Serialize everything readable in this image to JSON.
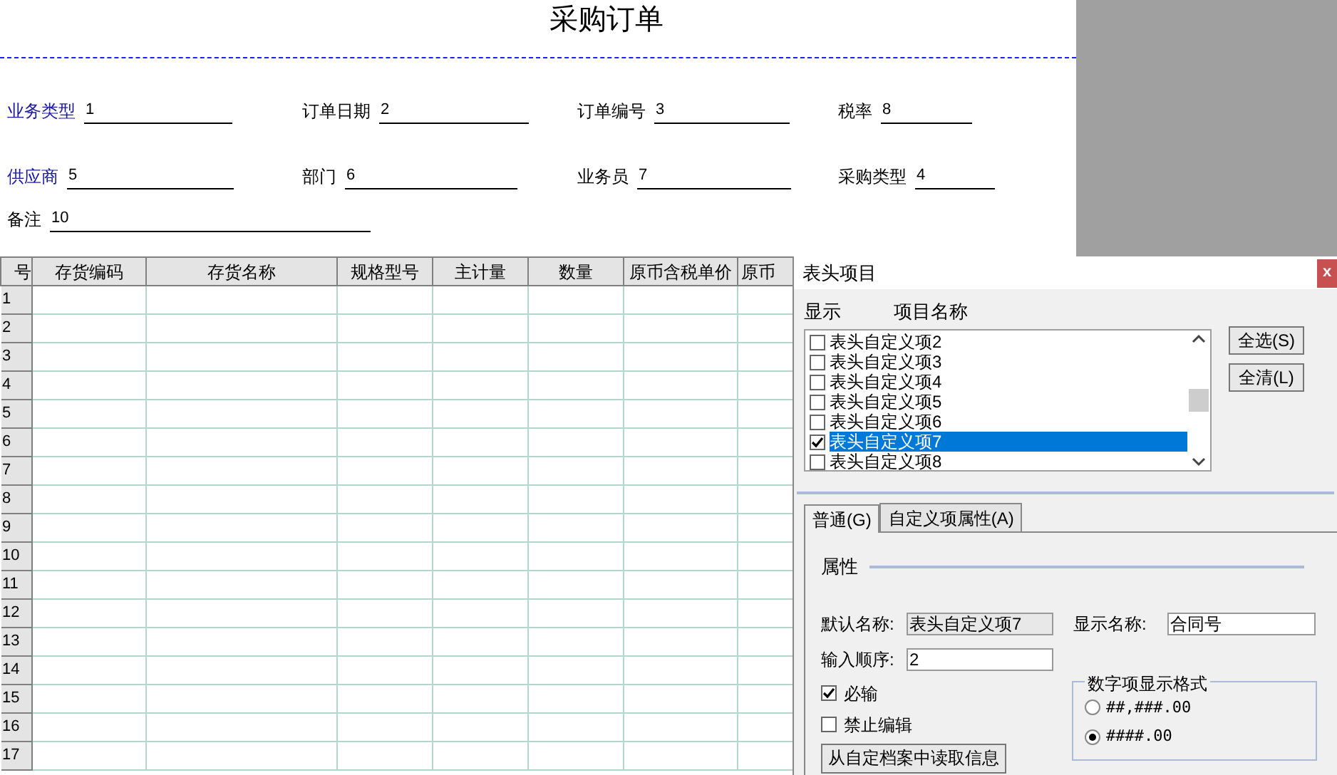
{
  "document": {
    "title": "采购订单",
    "field_rows": [
      {
        "fields": [
          {
            "label": "业务类型",
            "value": "1",
            "required": true
          },
          {
            "label": "订单日期",
            "value": "2",
            "required": false
          },
          {
            "label": "订单编号",
            "value": "3",
            "required": false
          },
          {
            "label": "税率",
            "value": "8",
            "required": false
          }
        ]
      },
      {
        "fields": [
          {
            "label": "供应商",
            "value": "5",
            "required": true
          },
          {
            "label": "部门",
            "value": "6",
            "required": false
          },
          {
            "label": "业务员",
            "value": "7",
            "required": false
          },
          {
            "label": "采购类型",
            "value": "4",
            "required": false
          }
        ]
      },
      {
        "fields": [
          {
            "label": "备注",
            "value": "10",
            "required": false
          }
        ]
      }
    ]
  },
  "table": {
    "columns": [
      "号",
      "存货编码",
      "存货名称",
      "规格型号",
      "主计量",
      "数量",
      "原币含税单价",
      "原币"
    ],
    "rows": [
      "1",
      "2",
      "3",
      "4",
      "5",
      "6",
      "7",
      "8",
      "9",
      "10",
      "11",
      "12",
      "13",
      "14",
      "15",
      "16",
      "17"
    ]
  },
  "dialog": {
    "title": "表头项目",
    "close": "x",
    "list_headers": [
      "显示",
      "项目名称"
    ],
    "items": [
      {
        "label": "表头自定义项2",
        "checked": false,
        "selected": false
      },
      {
        "label": "表头自定义项3",
        "checked": false,
        "selected": false
      },
      {
        "label": "表头自定义项4",
        "checked": false,
        "selected": false
      },
      {
        "label": "表头自定义项5",
        "checked": false,
        "selected": false
      },
      {
        "label": "表头自定义项6",
        "checked": false,
        "selected": false
      },
      {
        "label": "表头自定义项7",
        "checked": true,
        "selected": true
      },
      {
        "label": "表头自定义项8",
        "checked": false,
        "selected": false
      }
    ],
    "buttons": [
      "全选(S)",
      "全清(L)"
    ],
    "tabs": [
      {
        "label": "普通(G)",
        "selected": true
      },
      {
        "label": "自定义项属性(A)",
        "selected": false
      }
    ],
    "section": "属性",
    "default_name": {
      "label": "默认名称:",
      "value": "表头自定义项7"
    },
    "display_name": {
      "label": "显示名称:",
      "value": "合同号"
    },
    "input_order": {
      "label": "输入顺序:",
      "value": "2"
    },
    "checkboxes": [
      {
        "label": "必输",
        "checked": true
      },
      {
        "label": "禁止编辑",
        "checked": false
      }
    ],
    "read_button": "从自定档案中读取信息",
    "number_format": {
      "title": "数字项显示格式",
      "options": [
        {
          "label": "##,###.00",
          "selected": false
        },
        {
          "label": "####.00",
          "selected": true
        }
      ]
    }
  }
}
